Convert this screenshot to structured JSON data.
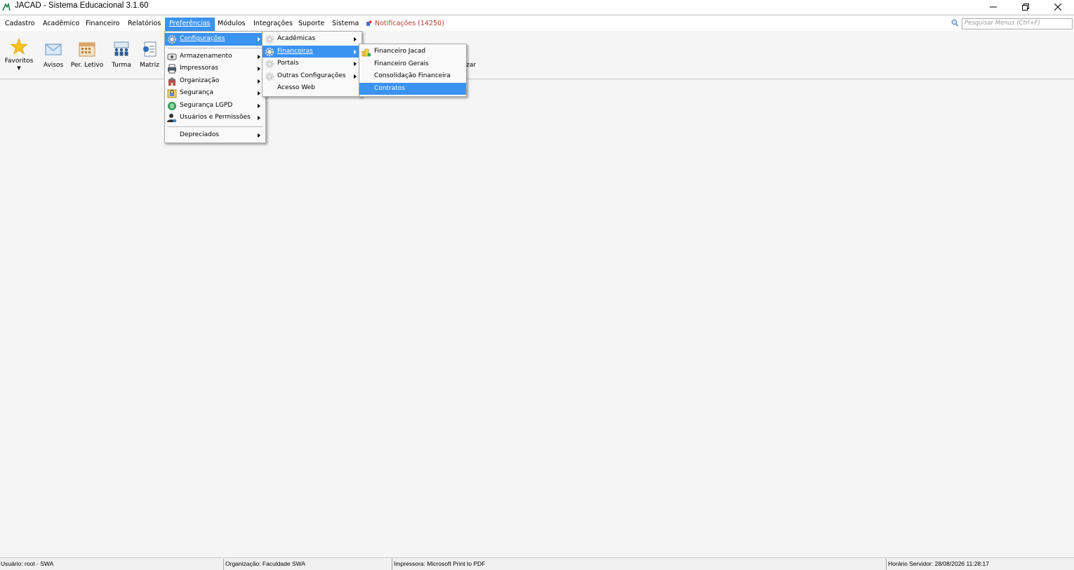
{
  "window": {
    "title": "JACAD - Sistema Educacional 3.1.60"
  },
  "menubar": {
    "items": [
      {
        "label": "Cadastro"
      },
      {
        "label": "Acadêmico"
      },
      {
        "label": "Financeiro"
      },
      {
        "label": "Relatórios"
      },
      {
        "label": "Preferências"
      },
      {
        "label": "Módulos"
      },
      {
        "label": "Integrações"
      },
      {
        "label": "Suporte"
      },
      {
        "label": "Sistema"
      }
    ],
    "notifications": "Notificações (14250)",
    "search_placeholder": "Pesquisar Menus (Ctrl+F)"
  },
  "toolbar": {
    "items": [
      {
        "label": "Favoritos",
        "icon": "star-icon"
      },
      {
        "label": "Avisos",
        "icon": "envelope-icon"
      },
      {
        "label": "Per. Letivo",
        "icon": "calendar-icon"
      },
      {
        "label": "Turma",
        "icon": "group-icon"
      },
      {
        "label": "Matriz",
        "icon": "document-list-icon"
      }
    ],
    "partial_label": "zar"
  },
  "preferencias_menu": {
    "items": [
      {
        "label": "Configurações",
        "icon": "gear-icon"
      },
      {
        "label": "Armazenamento",
        "icon": "database-icon"
      },
      {
        "label": "Impressoras",
        "icon": "printer-icon"
      },
      {
        "label": "Organização",
        "icon": "building-icon"
      },
      {
        "label": "Segurança",
        "icon": "lock-icon"
      },
      {
        "label": "Segurança LGPD",
        "icon": "shield-icon"
      },
      {
        "label": "Usuários e Permissões",
        "icon": "user-key-icon"
      },
      {
        "label": "Depreciados",
        "icon": ""
      }
    ]
  },
  "configuracoes_menu": {
    "items": [
      {
        "label": "Acadêmicas",
        "icon": "gear-icon"
      },
      {
        "label": "Financeiras",
        "icon": "gear-icon"
      },
      {
        "label": "Portais",
        "icon": "gear-icon"
      },
      {
        "label": "Outras Configurações",
        "icon": "gear-icon"
      },
      {
        "label": "Acesso Web",
        "icon": ""
      }
    ]
  },
  "financeiras_menu": {
    "items": [
      {
        "label": "Financeiro Jacad",
        "icon": "coins-icon"
      },
      {
        "label": "Financeiro Gerais"
      },
      {
        "label": "Consolidação Financeira"
      },
      {
        "label": "Contratos"
      }
    ]
  },
  "statusbar": {
    "user": "Usuário: root - SWA",
    "organization": "Organização: Faculdade SWA",
    "printer": "Impressora: Microsoft Print to PDF",
    "server_time": "Horário Servidor: 28/08/2026 11:28:17"
  },
  "colors": {
    "accent": "#3a93f0",
    "notification": "#c0392b"
  }
}
